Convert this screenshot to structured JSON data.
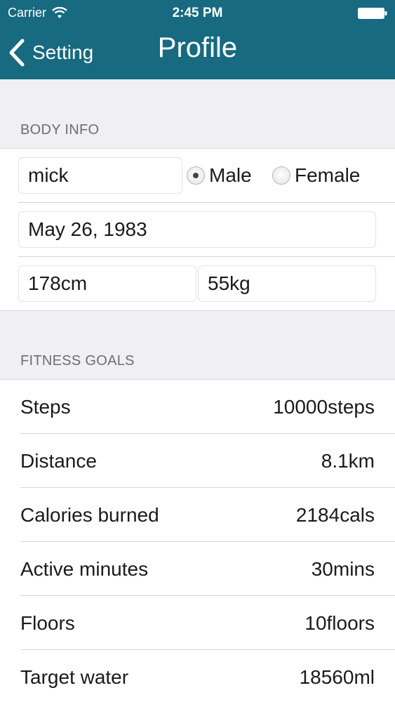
{
  "status_bar": {
    "carrier": "Carrier",
    "time": "2:45 PM"
  },
  "nav": {
    "back_label": "Setting",
    "title": "Profile"
  },
  "colors": {
    "header_bg": "#176a80",
    "section_bg": "#efeff4"
  },
  "body_info": {
    "section_label": "BODY INFO",
    "name": "mick",
    "gender_options": [
      "Male",
      "Female"
    ],
    "selected_gender": "Male",
    "birthday": "May 26, 1983",
    "height": "178cm",
    "weight": "55kg"
  },
  "fitness_goals": {
    "section_label": "FITNESS GOALS",
    "items": [
      {
        "label": "Steps",
        "value": "10000steps"
      },
      {
        "label": "Distance",
        "value": "8.1km"
      },
      {
        "label": "Calories burned",
        "value": "2184cals"
      },
      {
        "label": "Active minutes",
        "value": "30mins"
      },
      {
        "label": "Floors",
        "value": "10floors"
      },
      {
        "label": "Target water",
        "value": "18560ml"
      }
    ]
  }
}
